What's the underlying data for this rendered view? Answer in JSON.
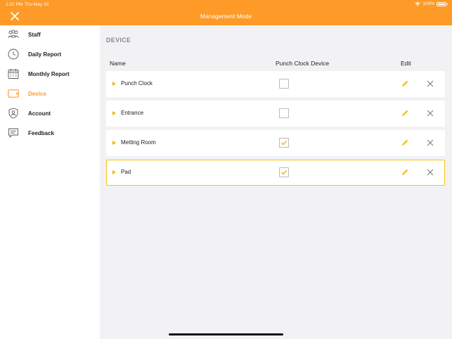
{
  "status_bar": {
    "time": "1:22 PM",
    "date": "Thu May 30",
    "battery": "100%"
  },
  "header": {
    "title": "Management Mode",
    "close_icon": "close-icon"
  },
  "sidebar": {
    "items": [
      {
        "label": "Staff",
        "icon": "people-icon",
        "active": false
      },
      {
        "label": "Daily Report",
        "icon": "clock-icon",
        "active": false
      },
      {
        "label": "Monthly Report",
        "icon": "calendar-icon",
        "active": false
      },
      {
        "label": "Device",
        "icon": "tablet-icon",
        "active": true
      },
      {
        "label": "Account",
        "icon": "account-shield-icon",
        "active": false
      },
      {
        "label": "Feedback",
        "icon": "chat-icon",
        "active": false
      }
    ]
  },
  "main": {
    "section_title": "DEVICE",
    "columns": {
      "name": "Name",
      "punch": "Punch Clock Device",
      "edit": "Edit"
    },
    "rows": [
      {
        "name": "Punch Clock",
        "punch_clock_device": false,
        "selected": false
      },
      {
        "name": "Entrance",
        "punch_clock_device": false,
        "selected": false
      },
      {
        "name": "Metting Room",
        "punch_clock_device": true,
        "selected": false
      },
      {
        "name": "Pad",
        "punch_clock_device": true,
        "selected": true
      }
    ]
  },
  "colors": {
    "accent": "#fd9a28",
    "check": "#f5b400",
    "edit_icon": "#f5c518",
    "selected_border": "#f5c518"
  }
}
